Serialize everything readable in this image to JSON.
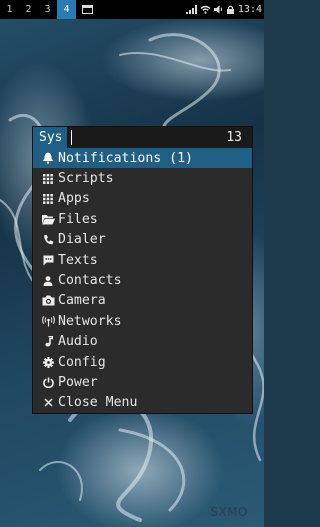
{
  "statusbar": {
    "workspaces": [
      "1",
      "2",
      "3",
      "4"
    ],
    "active_workspace": "4",
    "clock": "13:4"
  },
  "menu": {
    "prompt": "Sys",
    "input_value": "",
    "count": "13",
    "items": [
      {
        "label": "Notifications (1)",
        "icon": "bell-icon",
        "selected": true
      },
      {
        "label": "Scripts",
        "icon": "grid-icon"
      },
      {
        "label": "Apps",
        "icon": "grid-icon"
      },
      {
        "label": "Files",
        "icon": "folder-icon"
      },
      {
        "label": "Dialer",
        "icon": "phone-icon"
      },
      {
        "label": "Texts",
        "icon": "message-icon"
      },
      {
        "label": "Contacts",
        "icon": "person-icon"
      },
      {
        "label": "Camera",
        "icon": "camera-icon"
      },
      {
        "label": "Networks",
        "icon": "antenna-icon"
      },
      {
        "label": "Audio",
        "icon": "music-note-icon"
      },
      {
        "label": "Config",
        "icon": "gear-icon"
      },
      {
        "label": "Power",
        "icon": "power-icon"
      },
      {
        "label": "Close Menu",
        "icon": "close-icon"
      }
    ]
  },
  "watermark": "SXMO",
  "colors": {
    "accent": "#1f5f86",
    "workspace_active": "#2a7bb3",
    "menu_bg": "#2b2b2b"
  }
}
